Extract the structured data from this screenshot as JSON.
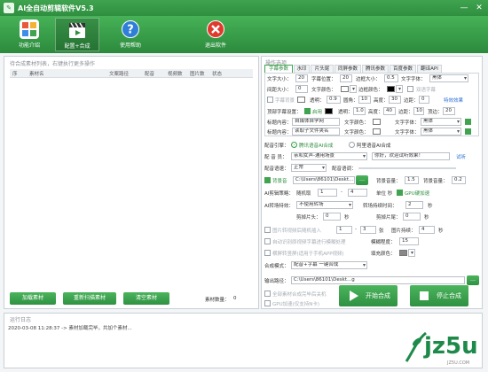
{
  "app": {
    "title": "AI全自动剪辑软件V5.3",
    "window_controls": {
      "min": "—",
      "close": "✕"
    }
  },
  "toolbar": {
    "items": [
      {
        "label": "功能介绍",
        "icon": "grid-icon"
      },
      {
        "label": "配置+合成",
        "icon": "film-clapper-icon"
      },
      {
        "label": "使用帮助",
        "icon": "help-icon"
      },
      {
        "label": "退出软件",
        "icon": "exit-icon"
      }
    ]
  },
  "material_panel": {
    "title": "待合成素材列表，右键执行更多操作",
    "columns": [
      "序",
      "素材名",
      "文案路径",
      "配音",
      "视频数",
      "图片数",
      "状态"
    ],
    "buttons": {
      "load": "加载素材",
      "rescan": "重新扫描素材",
      "clear": "清空素材"
    },
    "count_label": "素材数量：",
    "count_value": "0"
  },
  "log_panel": {
    "title": "运行日志",
    "lines": [
      "2020-03-08 11:28:37 -> 素材加载完毕，共加个素材..."
    ]
  },
  "options": {
    "title": "操作选项",
    "tabs": [
      "字幕参数",
      "水印",
      "片头尾",
      "同屏参数",
      "腾讯参数",
      "百度参数",
      "翻译API"
    ],
    "active_tab": 0,
    "rows": {
      "r1": {
        "l1": "文字大小：",
        "v1": "20",
        "l2": "字幕位置：",
        "v2": "20",
        "l3": "边框大小：",
        "v3": "0.5",
        "l4": "文字字体：",
        "v4": "黑体"
      },
      "r2": {
        "l1": "间距大小：",
        "v1": "0",
        "l2": "文字颜色：",
        "l3": "边框颜色：",
        "cb": "双语字幕"
      },
      "r3": {
        "cb": "字幕背景",
        "l1": "透明：",
        "v1": "0.9",
        "l2": "圆角：",
        "v2": "10",
        "l3": "高度：",
        "v3": "30",
        "l4": "边距：",
        "v4": "0",
        "link": "特效效果"
      },
      "r4": {
        "l1": "顶部字幕设置：",
        "cb": "启用",
        "l2": "透明：",
        "v2": "1.0",
        "l3": "高度：",
        "v3": "40",
        "l4": "边距：",
        "v4": "10",
        "l5": "顶边：",
        "v5": "20"
      },
      "r5": {
        "l1": "标题内容：",
        "v1": "自媒体自学网",
        "l2": "文字颜色：",
        "l3": "文字字体：",
        "v3": "黑体"
      },
      "r6": {
        "l1": "标题内容：",
        "v1": "读取子文件夹名",
        "l2": "文字颜色：",
        "l3": "文字字体：",
        "v3": "黑体"
      }
    },
    "voice_engine": {
      "label": "配音引擎：",
      "opt1": "腾讯语音AI合成",
      "opt2": "阿里语音AI合成"
    },
    "voice_actor": {
      "label": "配 音 员：",
      "value": "亲和女声-通用场景",
      "sample": "你好，欢迎试听效果！",
      "button": "试听"
    },
    "voice_speed": {
      "label": "配音语速：",
      "value": "正常",
      "l2": "配音语调："
    },
    "bgm": {
      "cb": "背景音",
      "path": "C:\\Users\\86101\\Deskt...",
      "l1": "背景音量：",
      "v1": "1.5",
      "l2": "背景音量：",
      "v2": "0.2"
    },
    "ai_cut": {
      "label": "AI剪辑策略：",
      "sub": "随机取",
      "v1": "1",
      "v2": "4",
      "l3": "单位 秒",
      "cb": "GPU硬加速"
    },
    "ai_trans": {
      "label": "AI转场特效：",
      "value": "不使用转场",
      "l2": "转场持续时间：",
      "v2": "2",
      "l3": "秒"
    },
    "cut_head": {
      "label": "剪掉片头：",
      "v1": "0",
      "l1": "秒",
      "l2": "剪掉片尾：",
      "v2": "0",
      "l3": "秒"
    },
    "img_row": {
      "cb": "图片转视频后随机插入",
      "v1": "1",
      "v2": "3",
      "l2": "张",
      "l3": "图片持续：",
      "v3": "4",
      "l4": "秒"
    },
    "aux_row": {
      "cb": "自动识别原视频字幕进行模糊处理",
      "l2": "模糊程度：",
      "v2": "15"
    },
    "crop_row": {
      "cb": "横屏转竖屏(适用于手机APP视频)",
      "l2": "填充颜色："
    },
    "compose_mode": {
      "label": "合成模式：",
      "value": "配音+字幕 一键合成"
    },
    "output": {
      "label": "输出路径：",
      "path": "C:\\Users\\86101\\Deskt...g"
    },
    "flags": {
      "f1": "全部素材合成完毕后关机",
      "f2": "GPU加速(仅支持N卡)"
    },
    "start_button": "开始合成",
    "stop_button": "停止合成"
  },
  "watermark": {
    "text": "jz5u",
    "sub": "JZ5U.COM"
  },
  "colors": {
    "brand_green": "#3fa34f",
    "text_green": "#2f8f40",
    "link_blue": "#2b6fd6",
    "watermark_green": "#1e8a4a"
  }
}
